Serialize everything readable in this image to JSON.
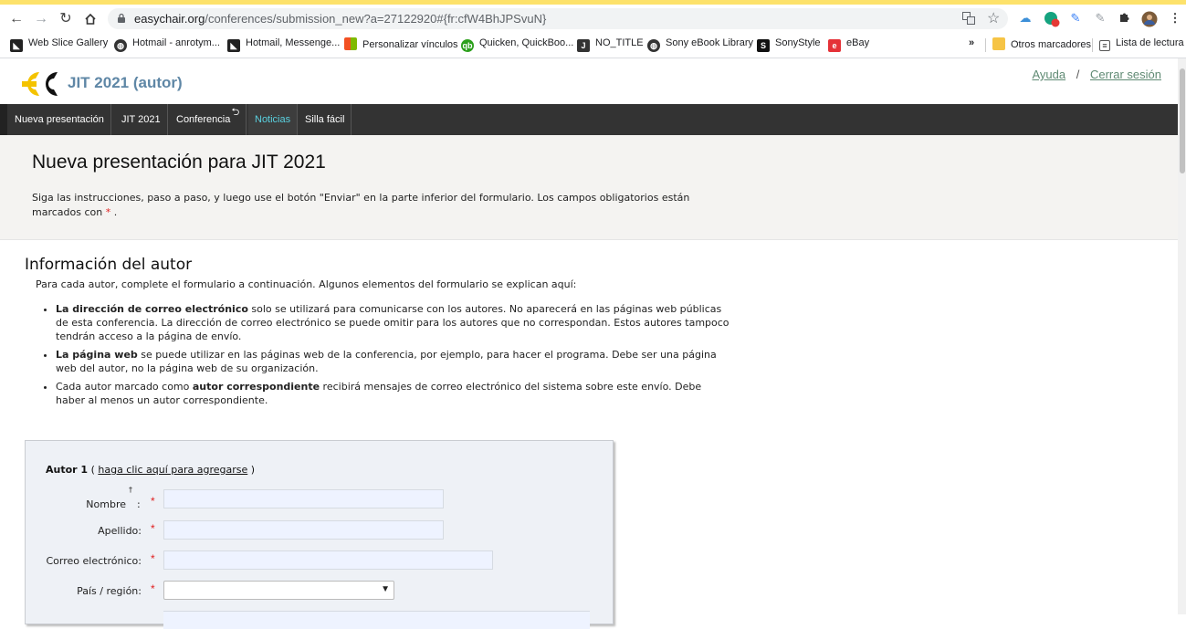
{
  "browser": {
    "url_host": "easychair.org",
    "url_path": "/conferences/submission_new?a=27122920#{fr:cfW4BhJPSvuN}"
  },
  "bookmarks": [
    {
      "label": "Web Slice Gallery",
      "icon": "web-slice-icon"
    },
    {
      "label": "Hotmail - anrotym...",
      "icon": "globe-icon"
    },
    {
      "label": "Hotmail, Messenge...",
      "icon": "web-slice-icon"
    },
    {
      "label": "Personalizar vínculos",
      "icon": "windows-icon"
    },
    {
      "label": "Quicken, QuickBoo...",
      "icon": "qb-icon"
    },
    {
      "label": "NO_TITLE",
      "icon": "j-icon"
    },
    {
      "label": "Sony eBook Library",
      "icon": "globe-icon"
    },
    {
      "label": "SonyStyle",
      "icon": "s-icon"
    },
    {
      "label": "eBay",
      "icon": "ebay-icon"
    }
  ],
  "bookmarks_right": {
    "more": "»",
    "other": "Otros marcadores",
    "reading": "Lista de lectura"
  },
  "app": {
    "title": "JIT 2021 (autor)",
    "help_link": "Ayuda",
    "separator": "/",
    "logout_link": "Cerrar sesión"
  },
  "menu": [
    {
      "label": "Nueva presentación",
      "active": false
    },
    {
      "label": "JIT 2021",
      "active": false
    },
    {
      "label": "Conferencia",
      "active": false
    },
    {
      "label": "Noticias",
      "active": true
    },
    {
      "label": "Silla fácil",
      "active": false
    }
  ],
  "intro": {
    "title": "Nueva presentación para JIT 2021",
    "text_before": "Siga las instrucciones, paso a paso, y luego use el botón \"Enviar\" en la parte inferior del formulario. Los campos obligatorios están marcados con ",
    "required_mark": "*",
    "text_after": " ."
  },
  "author_info": {
    "title": "Información del autor",
    "description": "Para cada autor, complete el formulario a continuación. Algunos elementos del formulario se explican aquí:",
    "bullets": [
      {
        "bold": "La dirección de correo electrónico",
        "rest_before": "",
        "rest": " solo se utilizará para comunicarse con los autores. No aparecerá en las páginas web públicas de esta conferencia. La dirección de correo electrónico se puede omitir para los autores que no correspondan. Estos autores tampoco tendrán acceso a la página de envío."
      },
      {
        "bold": "La página web",
        "rest_before": "",
        "rest": " se puede utilizar en las páginas web de la conferencia, por ejemplo, para hacer el programa. Debe ser una página web del autor, no la página web de su organización."
      },
      {
        "bold": "autor correspondiente",
        "rest_before": "Cada autor marcado como ",
        "rest": " recibirá mensajes de correo electrónico del sistema sobre este envío. Debe haber al menos un autor correspondiente."
      }
    ]
  },
  "author_form": {
    "heading": "Autor 1",
    "paren_open": "(",
    "self_link": "haga clic aquí para agregarse",
    "paren_close": ")",
    "fields": [
      {
        "label": "Nombre",
        "dagger": "†",
        "colon": ":",
        "required": "*",
        "value": ""
      },
      {
        "label": "Apellido:",
        "required": "*",
        "value": ""
      },
      {
        "label": "Correo electrónico:",
        "required": "*",
        "value": ""
      },
      {
        "label": "País / región:",
        "required": "*",
        "value": ""
      }
    ]
  }
}
